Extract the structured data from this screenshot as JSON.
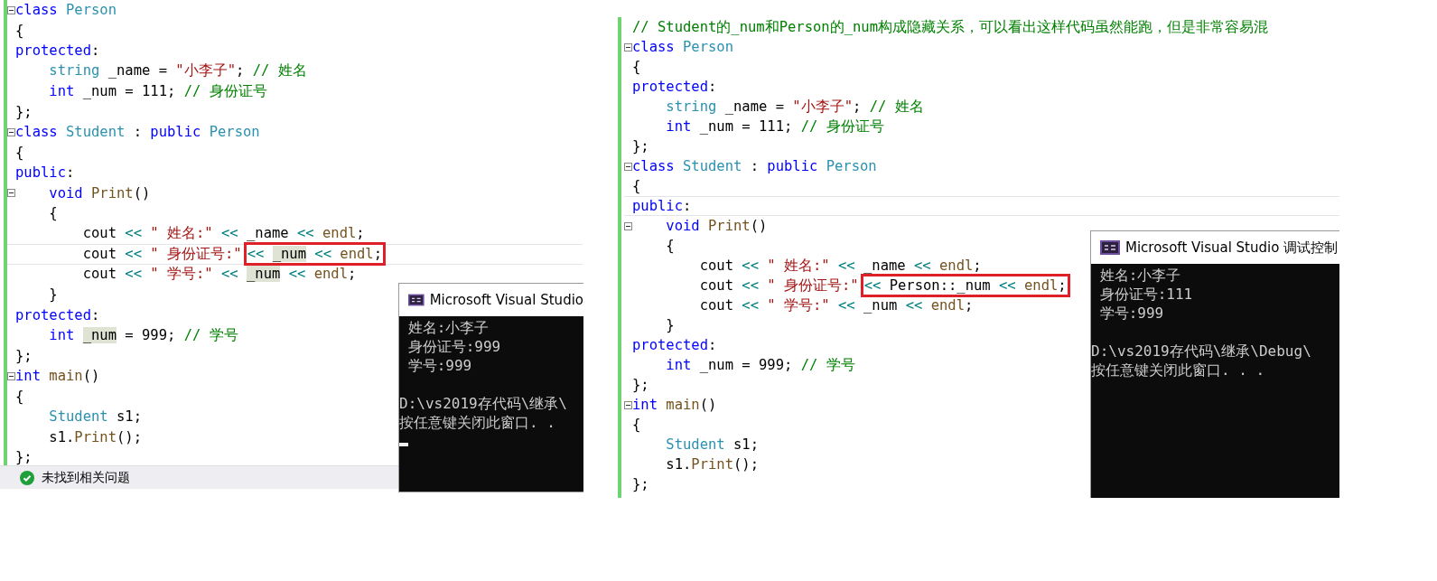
{
  "panes": [
    {
      "lines": [
        {
          "fold": true,
          "current": false,
          "tokens": [
            {
              "text": "class ",
              "kind": "kw"
            },
            {
              "text": "Person",
              "kind": "type"
            }
          ]
        },
        {
          "fold": false,
          "current": false,
          "tokens": [
            {
              "text": "{",
              "kind": "plain"
            }
          ]
        },
        {
          "fold": false,
          "current": false,
          "tokens": [
            {
              "text": "protected",
              "kind": "kw"
            },
            {
              "text": ":",
              "kind": "plain"
            }
          ]
        },
        {
          "fold": false,
          "current": false,
          "tokens": [
            {
              "text": "    string",
              "kind": "type"
            },
            {
              "text": " _name = ",
              "kind": "plain"
            },
            {
              "text": "\"小李子\"",
              "kind": "str"
            },
            {
              "text": "; ",
              "kind": "plain"
            },
            {
              "text": "// 姓名",
              "kind": "comment"
            }
          ]
        },
        {
          "fold": false,
          "current": false,
          "tokens": [
            {
              "text": "    int",
              "kind": "kw"
            },
            {
              "text": " _num = 111; ",
              "kind": "plain"
            },
            {
              "text": "// 身份证号",
              "kind": "comment"
            }
          ]
        },
        {
          "fold": false,
          "current": false,
          "tokens": [
            {
              "text": "};",
              "kind": "plain"
            }
          ]
        },
        {
          "fold": true,
          "current": false,
          "tokens": [
            {
              "text": "class ",
              "kind": "kw"
            },
            {
              "text": "Student",
              "kind": "type"
            },
            {
              "text": " : ",
              "kind": "plain"
            },
            {
              "text": "public ",
              "kind": "kw"
            },
            {
              "text": "Person",
              "kind": "type"
            }
          ]
        },
        {
          "fold": false,
          "current": false,
          "tokens": [
            {
              "text": "{",
              "kind": "plain"
            }
          ]
        },
        {
          "fold": false,
          "current": false,
          "tokens": [
            {
              "text": "public",
              "kind": "kw"
            },
            {
              "text": ":",
              "kind": "plain"
            }
          ]
        },
        {
          "fold": true,
          "current": false,
          "tokens": [
            {
              "text": "    void ",
              "kind": "kw"
            },
            {
              "text": "Print",
              "kind": "fn"
            },
            {
              "text": "()",
              "kind": "plain"
            }
          ]
        },
        {
          "fold": false,
          "current": false,
          "tokens": [
            {
              "text": "    {",
              "kind": "plain"
            }
          ]
        },
        {
          "fold": false,
          "current": false,
          "tokens": [
            {
              "text": "        cout ",
              "kind": "plain"
            },
            {
              "text": "<<",
              "kind": "op"
            },
            {
              "text": " \" 姓名:\" ",
              "kind": "str"
            },
            {
              "text": "<<",
              "kind": "op"
            },
            {
              "text": " _name ",
              "kind": "plain"
            },
            {
              "text": "<<",
              "kind": "op"
            },
            {
              "text": " endl",
              "kind": "fn"
            },
            {
              "text": ";",
              "kind": "plain"
            }
          ]
        },
        {
          "fold": false,
          "current": true,
          "tokens": [
            {
              "text": "        cout ",
              "kind": "plain"
            },
            {
              "text": "<<",
              "kind": "op"
            },
            {
              "text": " \" 身份证号:\"",
              "kind": "str"
            }
          ],
          "boxed": [
            {
              "text": "<< ",
              "kind": "op"
            },
            {
              "text": "_num",
              "kind": "ref"
            },
            {
              "text": " <<",
              "kind": "op"
            },
            {
              "text": " endl",
              "kind": "fn"
            },
            {
              "text": ";",
              "kind": "plain"
            }
          ]
        },
        {
          "fold": false,
          "current": false,
          "tokens": [
            {
              "text": "        cout ",
              "kind": "plain"
            },
            {
              "text": "<<",
              "kind": "op"
            },
            {
              "text": " \" 学号:\" ",
              "kind": "str"
            },
            {
              "text": "<< ",
              "kind": "op"
            },
            {
              "text": "_num",
              "kind": "ref"
            },
            {
              "text": " <<",
              "kind": "op"
            },
            {
              "text": " endl",
              "kind": "fn"
            },
            {
              "text": ";",
              "kind": "plain"
            }
          ]
        },
        {
          "fold": false,
          "current": false,
          "tokens": [
            {
              "text": "    }",
              "kind": "plain"
            }
          ]
        },
        {
          "fold": false,
          "current": false,
          "tokens": [
            {
              "text": "protected",
              "kind": "kw"
            },
            {
              "text": ":",
              "kind": "plain"
            }
          ]
        },
        {
          "fold": false,
          "current": false,
          "tokens": [
            {
              "text": "    int ",
              "kind": "kw"
            },
            {
              "text": "_num",
              "kind": "ref"
            },
            {
              "text": " = 999; ",
              "kind": "plain"
            },
            {
              "text": "// 学号",
              "kind": "comment"
            }
          ]
        },
        {
          "fold": false,
          "current": false,
          "tokens": [
            {
              "text": "};",
              "kind": "plain"
            }
          ]
        },
        {
          "fold": true,
          "current": false,
          "tokens": [
            {
              "text": "int ",
              "kind": "kw"
            },
            {
              "text": "main",
              "kind": "fn"
            },
            {
              "text": "()",
              "kind": "plain"
            }
          ]
        },
        {
          "fold": false,
          "current": false,
          "tokens": [
            {
              "text": "{",
              "kind": "plain"
            }
          ]
        },
        {
          "fold": false,
          "current": false,
          "tokens": [
            {
              "text": "    Student",
              "kind": "type"
            },
            {
              "text": " s1;",
              "kind": "plain"
            }
          ]
        },
        {
          "fold": false,
          "current": false,
          "tokens": [
            {
              "text": "    s1.",
              "kind": "plain"
            },
            {
              "text": "Print",
              "kind": "fn"
            },
            {
              "text": "();",
              "kind": "plain"
            }
          ]
        },
        {
          "fold": false,
          "current": false,
          "tokens": [
            {
              "text": "};",
              "kind": "plain"
            }
          ]
        }
      ],
      "status": "未找到相关问题",
      "console": {
        "title": "Microsoft Visual Studio",
        "cursor": true,
        "lines": [
          " 姓名:小李子",
          " 身份证号:999",
          " 学号:999",
          "D:\\vs2019存代码\\继承\\",
          "按任意键关闭此窗口. ."
        ]
      }
    },
    {
      "lines": [
        {
          "fold": false,
          "current": false,
          "tokens": [
            {
              "text": "// Student的_num和Person的_num构成隐藏关系，可以看出这样代码虽然能跑，但是非常容易混",
              "kind": "comment"
            }
          ]
        },
        {
          "fold": true,
          "current": false,
          "tokens": [
            {
              "text": "class ",
              "kind": "kw"
            },
            {
              "text": "Person",
              "kind": "type"
            }
          ]
        },
        {
          "fold": false,
          "current": false,
          "tokens": [
            {
              "text": "{",
              "kind": "plain"
            }
          ]
        },
        {
          "fold": false,
          "current": false,
          "tokens": [
            {
              "text": "protected",
              "kind": "kw"
            },
            {
              "text": ":",
              "kind": "plain"
            }
          ]
        },
        {
          "fold": false,
          "current": false,
          "tokens": [
            {
              "text": "    string",
              "kind": "type"
            },
            {
              "text": " _name = ",
              "kind": "plain"
            },
            {
              "text": "\"小李子\"",
              "kind": "str"
            },
            {
              "text": "; ",
              "kind": "plain"
            },
            {
              "text": "// 姓名",
              "kind": "comment"
            }
          ]
        },
        {
          "fold": false,
          "current": false,
          "tokens": [
            {
              "text": "    int",
              "kind": "kw"
            },
            {
              "text": " _num = 111; ",
              "kind": "plain"
            },
            {
              "text": "// 身份证号",
              "kind": "comment"
            }
          ]
        },
        {
          "fold": false,
          "current": false,
          "tokens": [
            {
              "text": "};",
              "kind": "plain"
            }
          ]
        },
        {
          "fold": true,
          "current": false,
          "tokens": [
            {
              "text": "class ",
              "kind": "kw"
            },
            {
              "text": "Student",
              "kind": "type"
            },
            {
              "text": " : ",
              "kind": "plain"
            },
            {
              "text": "public ",
              "kind": "kw"
            },
            {
              "text": "Person",
              "kind": "type"
            }
          ]
        },
        {
          "fold": false,
          "current": false,
          "tokens": [
            {
              "text": "{",
              "kind": "plain"
            }
          ]
        },
        {
          "fold": false,
          "current": true,
          "tokens": [
            {
              "text": "public",
              "kind": "kw"
            },
            {
              "text": ":",
              "kind": "plain"
            }
          ]
        },
        {
          "fold": true,
          "current": false,
          "tokens": [
            {
              "text": "    void ",
              "kind": "kw"
            },
            {
              "text": "Print",
              "kind": "fn"
            },
            {
              "text": "()",
              "kind": "plain"
            }
          ]
        },
        {
          "fold": false,
          "current": false,
          "tokens": [
            {
              "text": "    {",
              "kind": "plain"
            }
          ]
        },
        {
          "fold": false,
          "current": false,
          "tokens": [
            {
              "text": "        cout ",
              "kind": "plain"
            },
            {
              "text": "<<",
              "kind": "op"
            },
            {
              "text": " \" 姓名:\" ",
              "kind": "str"
            },
            {
              "text": "<<",
              "kind": "op"
            },
            {
              "text": " _name ",
              "kind": "plain"
            },
            {
              "text": "<<",
              "kind": "op"
            },
            {
              "text": " endl",
              "kind": "fn"
            },
            {
              "text": ";",
              "kind": "plain"
            }
          ]
        },
        {
          "fold": false,
          "current": false,
          "tokens": [
            {
              "text": "        cout ",
              "kind": "plain"
            },
            {
              "text": "<<",
              "kind": "op"
            },
            {
              "text": " \" 身份证号:\"",
              "kind": "str"
            }
          ],
          "boxed": [
            {
              "text": "<<",
              "kind": "op"
            },
            {
              "text": " Person::_num ",
              "kind": "plain"
            },
            {
              "text": "<<",
              "kind": "op"
            },
            {
              "text": " endl",
              "kind": "fn"
            },
            {
              "text": ";",
              "kind": "plain"
            }
          ]
        },
        {
          "fold": false,
          "current": false,
          "tokens": [
            {
              "text": "        cout ",
              "kind": "plain"
            },
            {
              "text": "<<",
              "kind": "op"
            },
            {
              "text": " \" 学号:\" ",
              "kind": "str"
            },
            {
              "text": "<<",
              "kind": "op"
            },
            {
              "text": " _num ",
              "kind": "plain"
            },
            {
              "text": "<<",
              "kind": "op"
            },
            {
              "text": " endl",
              "kind": "fn"
            },
            {
              "text": ";",
              "kind": "plain"
            }
          ]
        },
        {
          "fold": false,
          "current": false,
          "tokens": [
            {
              "text": "    }",
              "kind": "plain"
            }
          ]
        },
        {
          "fold": false,
          "current": false,
          "tokens": [
            {
              "text": "protected",
              "kind": "kw"
            },
            {
              "text": ":",
              "kind": "plain"
            }
          ]
        },
        {
          "fold": false,
          "current": false,
          "tokens": [
            {
              "text": "    int",
              "kind": "kw"
            },
            {
              "text": " _num = 999; ",
              "kind": "plain"
            },
            {
              "text": "// 学号",
              "kind": "comment"
            }
          ]
        },
        {
          "fold": false,
          "current": false,
          "tokens": [
            {
              "text": "};",
              "kind": "plain"
            }
          ]
        },
        {
          "fold": true,
          "current": false,
          "tokens": [
            {
              "text": "int ",
              "kind": "kw"
            },
            {
              "text": "main",
              "kind": "fn"
            },
            {
              "text": "()",
              "kind": "plain"
            }
          ]
        },
        {
          "fold": false,
          "current": false,
          "tokens": [
            {
              "text": "{",
              "kind": "plain"
            }
          ]
        },
        {
          "fold": false,
          "current": false,
          "tokens": [
            {
              "text": "    Student",
              "kind": "type"
            },
            {
              "text": " s1;",
              "kind": "plain"
            }
          ]
        },
        {
          "fold": false,
          "current": false,
          "tokens": [
            {
              "text": "    s1.",
              "kind": "plain"
            },
            {
              "text": "Print",
              "kind": "fn"
            },
            {
              "text": "();",
              "kind": "plain"
            }
          ]
        },
        {
          "fold": false,
          "current": false,
          "tokens": [
            {
              "text": "};",
              "kind": "plain"
            }
          ]
        }
      ],
      "console": {
        "title": "Microsoft Visual Studio 调试控制",
        "cursor": false,
        "lines": [
          " 姓名:小李子",
          " 身份证号:111",
          " 学号:999",
          "D:\\vs2019存代码\\继承\\Debug\\",
          "按任意键关闭此窗口. . ."
        ]
      }
    }
  ]
}
